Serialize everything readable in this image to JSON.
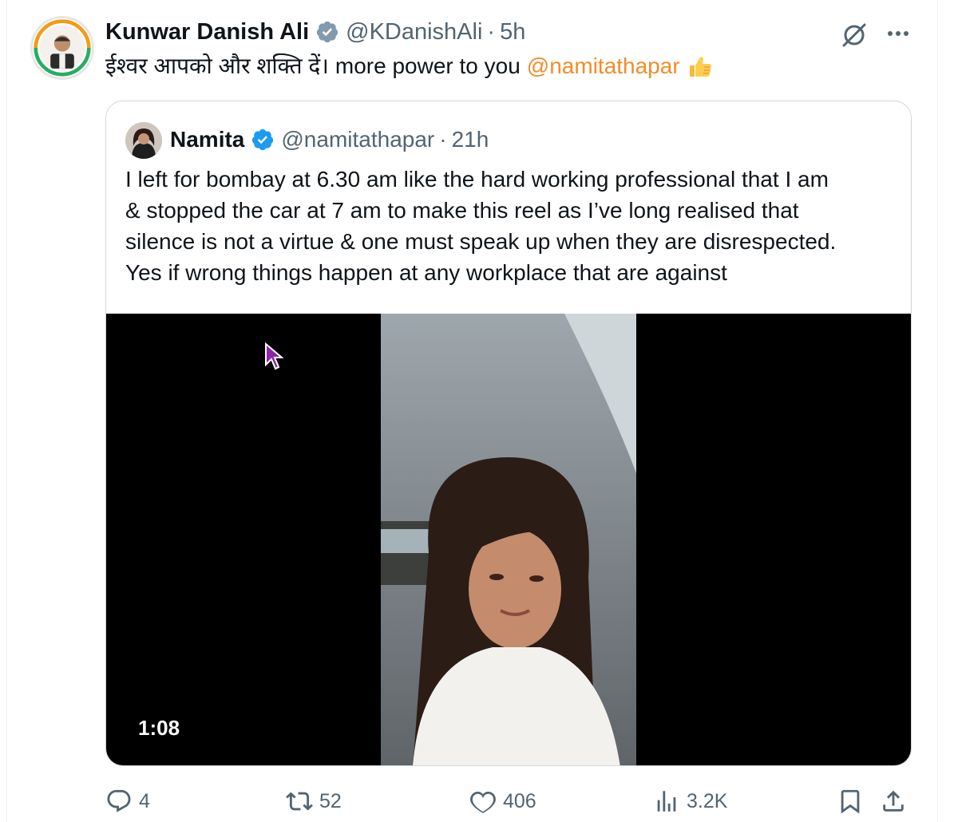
{
  "tweet": {
    "author_name": "Kunwar Danish Ali",
    "handle": "@KDanishAli",
    "separator": "·",
    "time": "5h",
    "text_hindi": "ईश्वर आपको और शक्ति दें।",
    "text_english": "more power to you",
    "mention": "@namitathapar",
    "verified_badge_color": "#829aab",
    "mention_color": "#f28c28",
    "icons": [
      "verified-gray-badge-icon",
      "grok-icon",
      "more-icon",
      "thumbs-up-emoji"
    ]
  },
  "quote": {
    "author_name": "Namita",
    "handle": "@namitathapar",
    "separator": "·",
    "time": "21h",
    "verified_badge_color": "#1d9bf0",
    "lines": [
      "I left for bombay at 6.30 am like the hard working professional that I am",
      "& stopped the car at 7 am to make this reel as I’ve long realised that",
      "silence is not a virtue & one must speak up when they are disrespected.",
      "Yes if wrong things happen at any workplace that are against"
    ],
    "video": {
      "duration": "1:08"
    }
  },
  "actions": {
    "replies": "4",
    "reposts": "52",
    "likes": "406",
    "views": "3.2K",
    "icons": [
      "reply-icon",
      "repost-icon",
      "like-icon",
      "views-icon",
      "bookmark-icon",
      "share-icon"
    ]
  }
}
